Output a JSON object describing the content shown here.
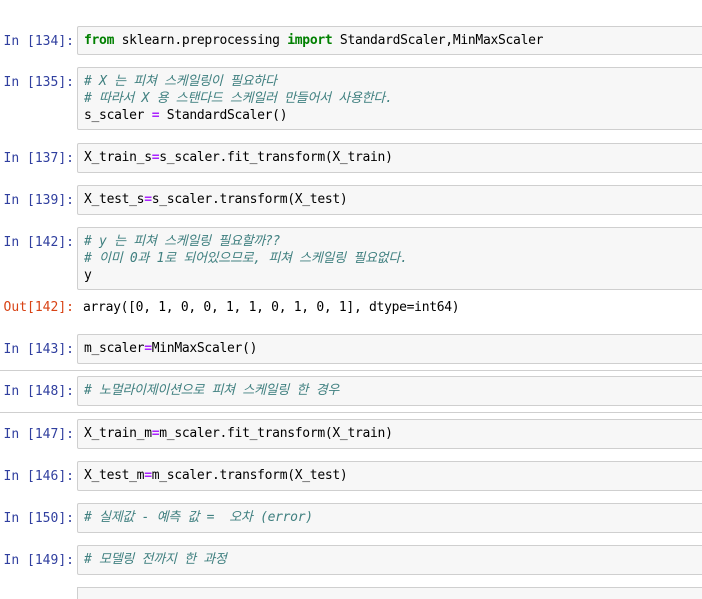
{
  "cells": [
    {
      "prompt": "In [134]:",
      "tokens": [
        {
          "t": "from",
          "c": "kw"
        },
        {
          "t": " sklearn.preprocessing ",
          "c": "plain"
        },
        {
          "t": "import",
          "c": "kw"
        },
        {
          "t": " StandardScaler,MinMaxScaler",
          "c": "plain"
        }
      ]
    },
    {
      "prompt": "In [135]:",
      "line1": "# X 는 피쳐 스케일링이 필요하다",
      "line2": "# 따라서 X 용 스탠다드 스케일러 만들어서 사용한다.",
      "line3a": "s_scaler ",
      "line3b": "=",
      "line3c": " StandardScaler()"
    },
    {
      "prompt": "In [137]:",
      "a": "X_train_s",
      "b": "=",
      "c": "s_scaler.fit_transform(X_train)"
    },
    {
      "prompt": "In [139]:",
      "a": "X_test_s",
      "b": "=",
      "c": "s_scaler.transform(X_test)"
    },
    {
      "prompt": "In [142]:",
      "line1": "# y 는 피쳐 스케일링 필요할까??",
      "line2": "# 이미 0과 1로 되어있으므로, 피쳐 스케일링 필요없다.",
      "line3": "y"
    },
    {
      "prompt": "Out[142]:",
      "text": "array([0, 1, 0, 0, 1, 1, 0, 1, 0, 1], dtype=int64)"
    },
    {
      "prompt": "In [143]:",
      "a": "m_scaler",
      "b": "=",
      "c": "MinMaxScaler()"
    },
    {
      "prompt": "In [148]:",
      "comment": "# 노멀라이제이션으로 피쳐 스케일링 한 경우"
    },
    {
      "prompt": "In [147]:",
      "a": "X_train_m",
      "b": "=",
      "c": "m_scaler.fit_transform(X_train)"
    },
    {
      "prompt": "In [146]:",
      "a": "X_test_m",
      "b": "=",
      "c": "m_scaler.transform(X_test)"
    },
    {
      "prompt": "In [150]:",
      "comment": "# 실제값 - 예측 값 =  오차 (error)"
    },
    {
      "prompt": "In [149]:",
      "comment": "# 모델링 전까지 한 과정"
    }
  ]
}
